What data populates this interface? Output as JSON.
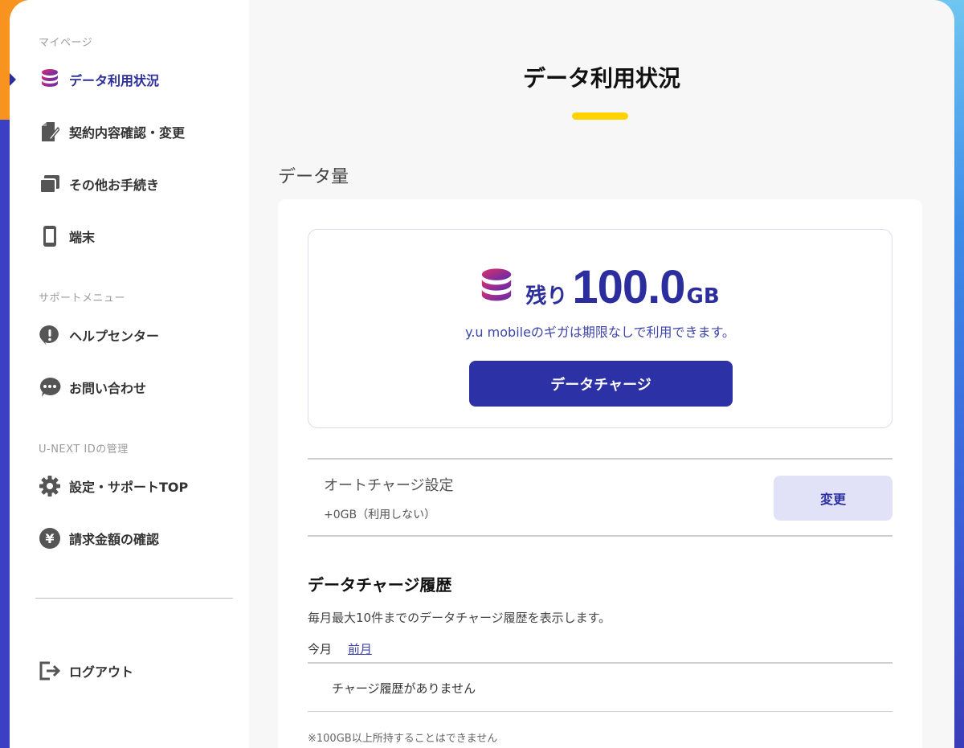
{
  "sidebar": {
    "section_mypage": "マイページ",
    "items_mypage": [
      {
        "label": "データ利用状況",
        "icon": "database-icon",
        "active": true
      },
      {
        "label": "契約内容確認・変更",
        "icon": "document-edit-icon"
      },
      {
        "label": "その他お手続き",
        "icon": "stacked-windows-icon"
      },
      {
        "label": "端末",
        "icon": "smartphone-icon"
      }
    ],
    "section_support": "サポートメニュー",
    "items_support": [
      {
        "label": "ヘルプセンター",
        "icon": "alert-bubble-icon"
      },
      {
        "label": "お問い合わせ",
        "icon": "chat-bubble-icon"
      }
    ],
    "section_unext": "U-NEXT IDの管理",
    "items_unext": [
      {
        "label": "設定・サポートTOP",
        "icon": "gear-icon"
      },
      {
        "label": "請求金額の確認",
        "icon": "yen-icon"
      }
    ],
    "logout_label": "ログアウト"
  },
  "main": {
    "page_title": "データ利用状況",
    "section_title": "データ量",
    "remain": {
      "label": "残り",
      "value": "100.0",
      "unit": "GB",
      "note": "y.u mobileのギガは期限なしで利用できます。",
      "charge_button": "データチャージ"
    },
    "auto_charge": {
      "title": "オートチャージ設定",
      "value": "+0GB（利用しない）",
      "change_button": "変更"
    },
    "history": {
      "title": "データチャージ履歴",
      "description": "毎月最大10件までのデータチャージ履歴を表示します。",
      "tab_current": "今月",
      "tab_previous": "前月",
      "empty_message": "チャージ履歴がありません"
    },
    "footnote": "※100GB以上所持することはできません"
  },
  "colors": {
    "accent": "#2b2e9c",
    "title_underline": "#ffd200",
    "change_button_bg": "#e1e2f8"
  }
}
